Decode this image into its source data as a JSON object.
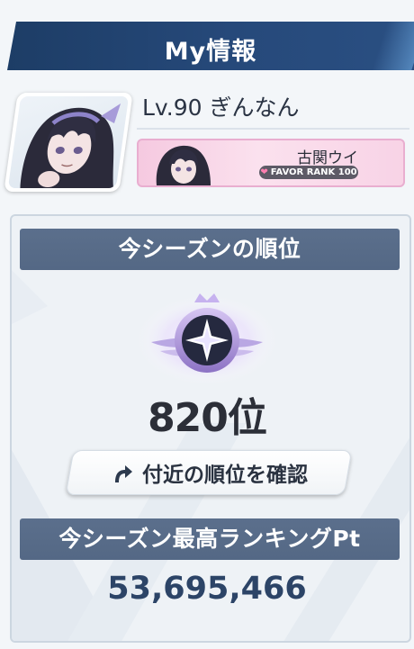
{
  "header": {
    "title": "My情報"
  },
  "profile": {
    "level_name": "Lv.90 ぎんなん",
    "avatar_icon": "student-portrait-icon"
  },
  "favor": {
    "student_name": "古関ウイ",
    "rank_label": "FAVOR RANK 100",
    "heart_icon": "heart-icon"
  },
  "season": {
    "rank_header": "今シーズンの順位",
    "rank_value": "820位",
    "emblem_icon": "rank-emblem-icon",
    "nearby_button": "付近の順位を確認",
    "nearby_icon": "curved-arrow-icon",
    "best_header": "今シーズン最高ランキングPt",
    "best_value": "53,695,466"
  },
  "colors": {
    "header_bg": "#1d3d66",
    "section_bar": "#5b6f8c",
    "best_value": "#2c4467",
    "favor_pink": "#f5c9e0"
  }
}
